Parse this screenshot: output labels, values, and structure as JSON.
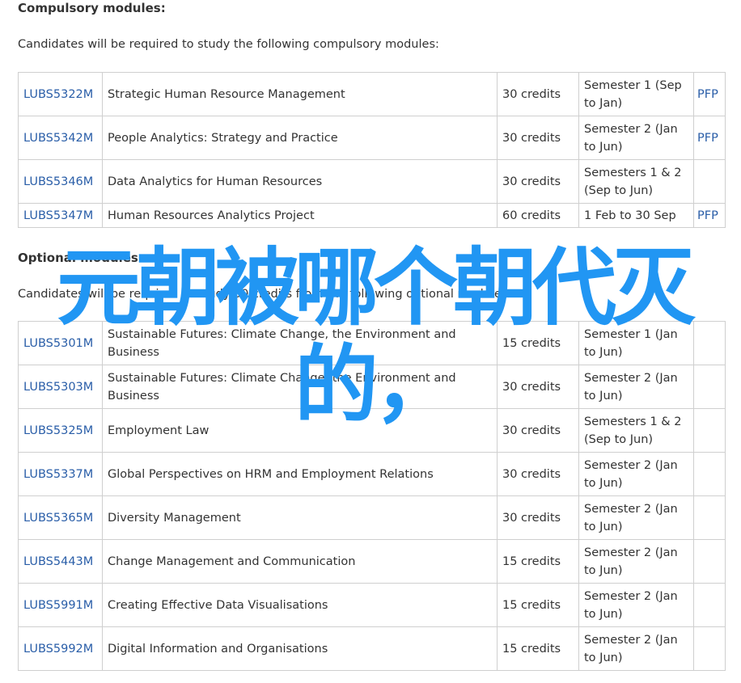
{
  "compulsory": {
    "heading": "Compulsory modules:",
    "intro": "Candidates will be required to study the following compulsory modules:",
    "rows": [
      {
        "code": "LUBS5322M",
        "title": "Strategic Human Resource Management",
        "credits": "30 credits",
        "semester": "Semester 1 (Sep to Jan)",
        "pfp": "PFP"
      },
      {
        "code": "LUBS5342M",
        "title": "People Analytics: Strategy and Practice",
        "credits": "30 credits",
        "semester": "Semester 2 (Jan to Jun)",
        "pfp": "PFP"
      },
      {
        "code": "LUBS5346M",
        "title": "Data Analytics for Human Resources",
        "credits": "30 credits",
        "semester": "Semesters 1 & 2 (Sep to Jun)",
        "pfp": ""
      },
      {
        "code": "LUBS5347M",
        "title": "Human Resources Analytics Project",
        "credits": "60 credits",
        "semester": "1 Feb to 30 Sep",
        "pfp": "PFP"
      }
    ]
  },
  "optional": {
    "heading": "Optional modules:",
    "intro": "Candidates will be required to study 30 credits from the following optional modules:",
    "rows": [
      {
        "code": "LUBS5301M",
        "title": "Sustainable Futures: Climate Change, the Environment and Business",
        "credits": "15 credits",
        "semester": "Semester 1 (Jan to Jun)",
        "pfp": ""
      },
      {
        "code": "LUBS5303M",
        "title": "Sustainable Futures: Climate Change, the Environment and Business",
        "credits": "30 credits",
        "semester": "Semester 2 (Jan to Jun)",
        "pfp": ""
      },
      {
        "code": "LUBS5325M",
        "title": "Employment Law",
        "credits": "30 credits",
        "semester": "Semesters 1 & 2 (Sep to Jun)",
        "pfp": ""
      },
      {
        "code": "LUBS5337M",
        "title": "Global Perspectives on HRM and Employment Relations",
        "credits": "30 credits",
        "semester": "Semester 2 (Jan to Jun)",
        "pfp": ""
      },
      {
        "code": "LUBS5365M",
        "title": "Diversity Management",
        "credits": "30 credits",
        "semester": "Semester 2 (Jan to Jun)",
        "pfp": ""
      },
      {
        "code": "LUBS5443M",
        "title": "Change Management and Communication",
        "credits": "15 credits",
        "semester": "Semester 2 (Jan to Jun)",
        "pfp": ""
      },
      {
        "code": "LUBS5991M",
        "title": "Creating Effective Data Visualisations",
        "credits": "15 credits",
        "semester": "Semester 2 (Jan to Jun)",
        "pfp": ""
      },
      {
        "code": "LUBS5992M",
        "title": "Digital Information and Organisations",
        "credits": "15 credits",
        "semester": "Semester 2 (Jan to Jun)",
        "pfp": ""
      }
    ]
  },
  "overlay": {
    "text": "元朝被哪个朝代灭的，",
    "color": "#2196f3"
  },
  "colors": {
    "link": "#2a5ea8",
    "text": "#333333",
    "border": "#cfcfcf"
  }
}
